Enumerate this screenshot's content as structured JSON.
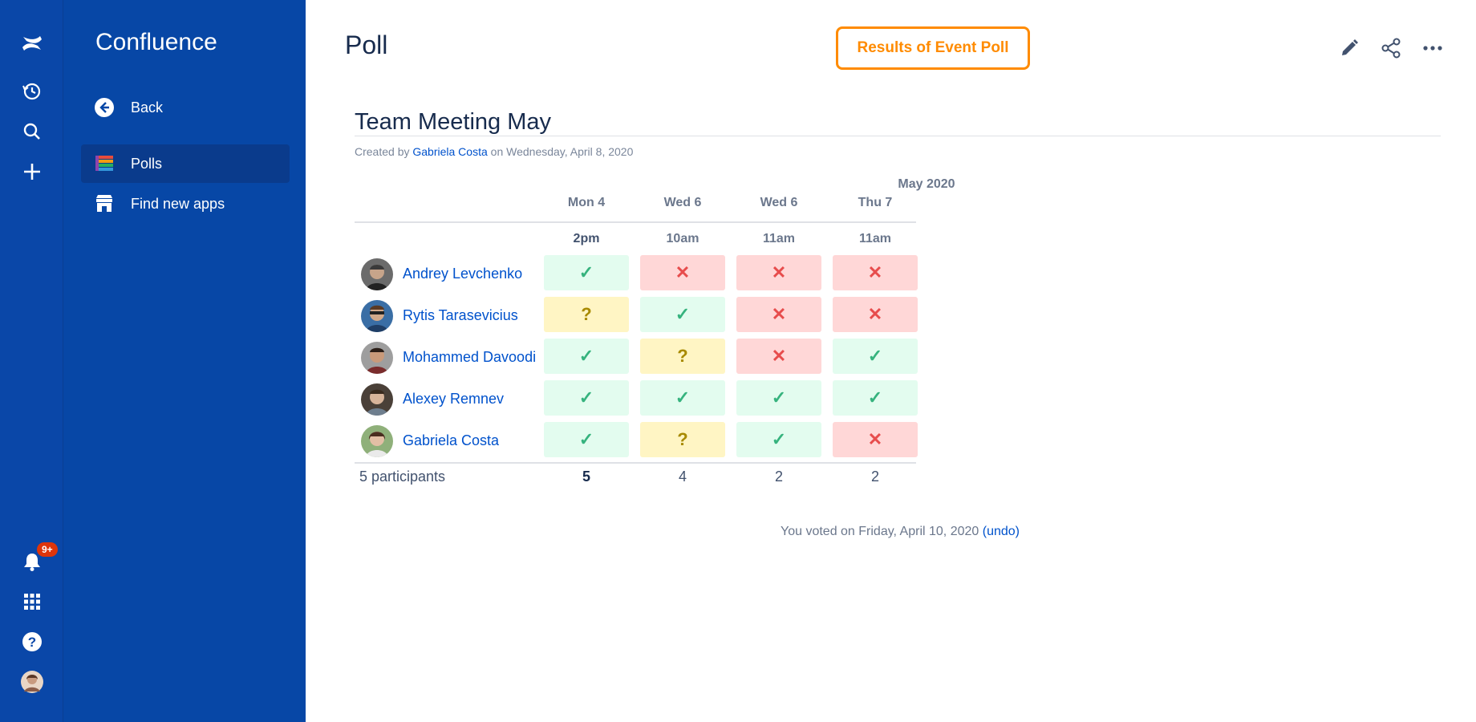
{
  "global_nav": {
    "icons": [
      "confluence-logo-icon",
      "recent-icon",
      "search-icon",
      "create-icon",
      "notifications-icon",
      "app-switcher-icon",
      "help-icon",
      "profile-avatar"
    ],
    "notification_badge": "9+"
  },
  "sidebar": {
    "brand": "Confluence",
    "items": [
      {
        "label": "Back",
        "icon": "back-arrow-icon"
      },
      {
        "label": "Polls",
        "icon": "polls-icon",
        "active": true
      },
      {
        "label": "Find new apps",
        "icon": "store-icon"
      }
    ]
  },
  "header": {
    "title": "Poll",
    "results_button": "Results of Event Poll",
    "tools": [
      "edit-icon",
      "share-icon",
      "more-icon"
    ]
  },
  "poll": {
    "title": "Team Meeting May",
    "created_prefix": "Created by",
    "creator": "Gabriela Costa",
    "created_on": "on Wednesday, April 8, 2020",
    "month": "May 2020",
    "columns": [
      {
        "day": "Mon 4",
        "time": "2pm"
      },
      {
        "day": "Wed 6",
        "time": "10am"
      },
      {
        "day": "Wed 6",
        "time": "11am"
      },
      {
        "day": "Thu 7",
        "time": "11am"
      }
    ],
    "participants": [
      {
        "name": "Andrey Levchenko",
        "votes": [
          "yes",
          "no",
          "no",
          "no"
        ]
      },
      {
        "name": "Rytis Tarasevicius",
        "votes": [
          "maybe",
          "yes",
          "no",
          "no"
        ]
      },
      {
        "name": "Mohammed Davoodi",
        "votes": [
          "yes",
          "maybe",
          "no",
          "yes"
        ]
      },
      {
        "name": "Alexey Remnev",
        "votes": [
          "yes",
          "yes",
          "yes",
          "yes"
        ]
      },
      {
        "name": "Gabriela Costa",
        "votes": [
          "yes",
          "maybe",
          "yes",
          "no"
        ]
      }
    ],
    "participants_label": "5 participants",
    "totals": [
      "5",
      "4",
      "2",
      "2"
    ],
    "voted_text": "You voted on Friday, April 10, 2020",
    "undo_label": "(undo)"
  },
  "colors": {
    "nav": "#0A47A8",
    "sidebar": "#0747A6",
    "accent_orange": "#FF8B00",
    "yes": "#E3FCEF",
    "no": "#FFD7D7",
    "maybe": "#FFF5C4"
  }
}
